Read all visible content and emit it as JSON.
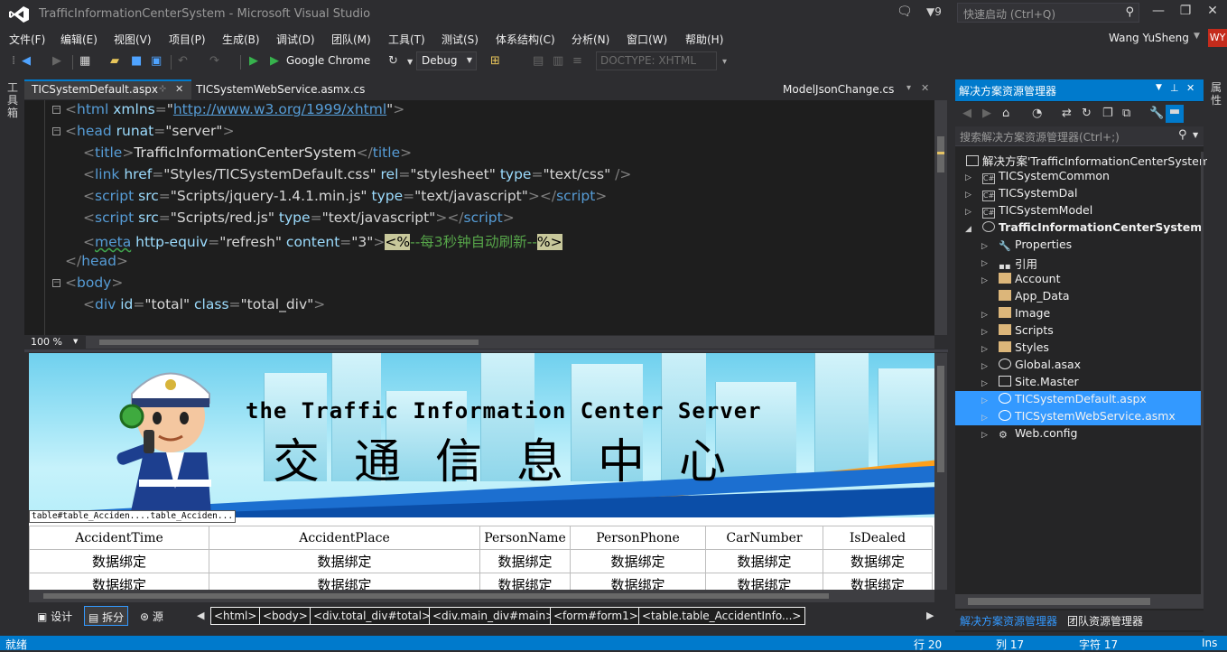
{
  "window": {
    "title": "TrafficInformationCenterSystem - Microsoft Visual Studio",
    "notification_count": "9",
    "quick_launch_placeholder": "快速启动 (Ctrl+Q)"
  },
  "menu": [
    "文件(F)",
    "编辑(E)",
    "视图(V)",
    "项目(P)",
    "生成(B)",
    "调试(D)",
    "团队(M)",
    "工具(T)",
    "测试(S)",
    "体系结构(C)",
    "分析(N)",
    "窗口(W)",
    "帮助(H)"
  ],
  "user": {
    "name": "Wang YuSheng",
    "initials": "WY"
  },
  "toolbar": {
    "browser": "Google Chrome",
    "configuration": "Debug",
    "doctype": "DOCTYPE:  XHTML"
  },
  "toolbox_label": "工具箱",
  "tabs": {
    "active": "TICSystemDefault.aspx",
    "second": "TICSystemWebService.asmx.cs",
    "preview": "ModelJsonChange.cs"
  },
  "code": {
    "l1": {
      "open": "<",
      "tag": "html",
      "attr": " xmlns",
      "eq": "=",
      "q1": "\"",
      "url": "http://www.w3.org/1999/xhtml",
      "q2": "\"",
      "close": ">"
    },
    "l2": {
      "open": "<",
      "tag": "head",
      "attr": " runat",
      "eq": "=",
      "val": "\"server\"",
      "close": ">"
    },
    "l3": {
      "open": "<",
      "tag": "title",
      "gt": ">",
      "text": "TrafficInformationCenterSystem",
      "lt": "</",
      "tag2": "title",
      "close": ">"
    },
    "l4": {
      "open": "<",
      "tag": "link",
      "a1": " href",
      "v1": "\"Styles/TICSystemDefault.css\"",
      "a2": " rel",
      "v2": "\"stylesheet\"",
      "a3": " type",
      "v3": "\"text/css\"",
      "close": " />"
    },
    "l5": {
      "open": "<",
      "tag": "script",
      "a1": " src",
      "v1": "\"Scripts/jquery-1.4.1.min.js\"",
      "a2": " type",
      "v2": "\"text/javascript\"",
      "gt": ">",
      "lt": "</",
      "tag2": "script",
      "close": ">"
    },
    "l6": {
      "open": "<",
      "tag": "script",
      "a1": " src",
      "v1": "\"Scripts/red.js\"",
      "a2": " type",
      "v2": "\"text/javascript\"",
      "gt": ">",
      "lt": "</",
      "tag2": "script",
      "close": ">"
    },
    "l7": {
      "open": "<",
      "tag": "meta",
      "a1": " http-equiv",
      "v1": "\"refresh\"",
      "a2": " content",
      "v2": "\"3\"",
      "close": ">",
      "asp_open": "<%",
      "comment": "--每3秒钟自动刷新--",
      "asp_close": "%>"
    },
    "l8": {
      "open": "</",
      "tag": "head",
      "close": ">"
    },
    "l9": {
      "open": "<",
      "tag": "body",
      "close": ">"
    },
    "l10": {
      "open": "<",
      "tag": "div",
      "a1": " id",
      "v1": "\"total\"",
      "a2": " class",
      "v2": "\"total_div\"",
      "close": ">"
    },
    "eq": "="
  },
  "editor": {
    "zoom": "100 %"
  },
  "design": {
    "banner_en": "the Traffic Information Center Server",
    "banner_cn": "交通信息中心",
    "selection_label": "table#table_Acciden....table_Acciden...",
    "columns": [
      "AccidentTime",
      "AccidentPlace",
      "PersonName",
      "PersonPhone",
      "CarNumber",
      "IsDealed"
    ],
    "row_values": [
      "数据绑定",
      "数据绑定",
      "数据绑定",
      "数据绑定",
      "数据绑定",
      "数据绑定"
    ]
  },
  "bottom_views": {
    "design": "设计",
    "split": "拆分",
    "source": "源"
  },
  "breadcrumbs": [
    "<html>",
    "<body>",
    "<div.total_div#total>",
    "<div.main_div#main>",
    "<form#form1>",
    "<table.table_AccidentInfo...>"
  ],
  "solution_explorer": {
    "title": "解决方案资源管理器",
    "search_placeholder": "搜索解决方案资源管理器(Ctrl+;)",
    "items": [
      {
        "label": "解决方案'TrafficInformationCenterSystem'"
      },
      {
        "label": "TICSystemCommon"
      },
      {
        "label": "TICSystemDal"
      },
      {
        "label": "TICSystemModel"
      },
      {
        "label": "TrafficInformationCenterSystem"
      },
      {
        "label": "Properties"
      },
      {
        "label": "引用"
      },
      {
        "label": "Account"
      },
      {
        "label": "App_Data"
      },
      {
        "label": "Image"
      },
      {
        "label": "Scripts"
      },
      {
        "label": "Styles"
      },
      {
        "label": "Global.asax"
      },
      {
        "label": "Site.Master"
      },
      {
        "label": "TICSystemDefault.aspx"
      },
      {
        "label": "TICSystemWebService.asmx"
      },
      {
        "label": "Web.config"
      }
    ],
    "bottom_tabs": [
      "解决方案资源管理器",
      "团队资源管理器"
    ]
  },
  "right_strip_label": "属性",
  "status": {
    "ready": "就绪",
    "line": "行 20",
    "col": "列 17",
    "char": "字符 17",
    "mode": "Ins"
  },
  "colors": {
    "accent": "#007acc",
    "selection": "#3399ff",
    "background": "#2d2d30",
    "editor": "#1e1e1e"
  }
}
